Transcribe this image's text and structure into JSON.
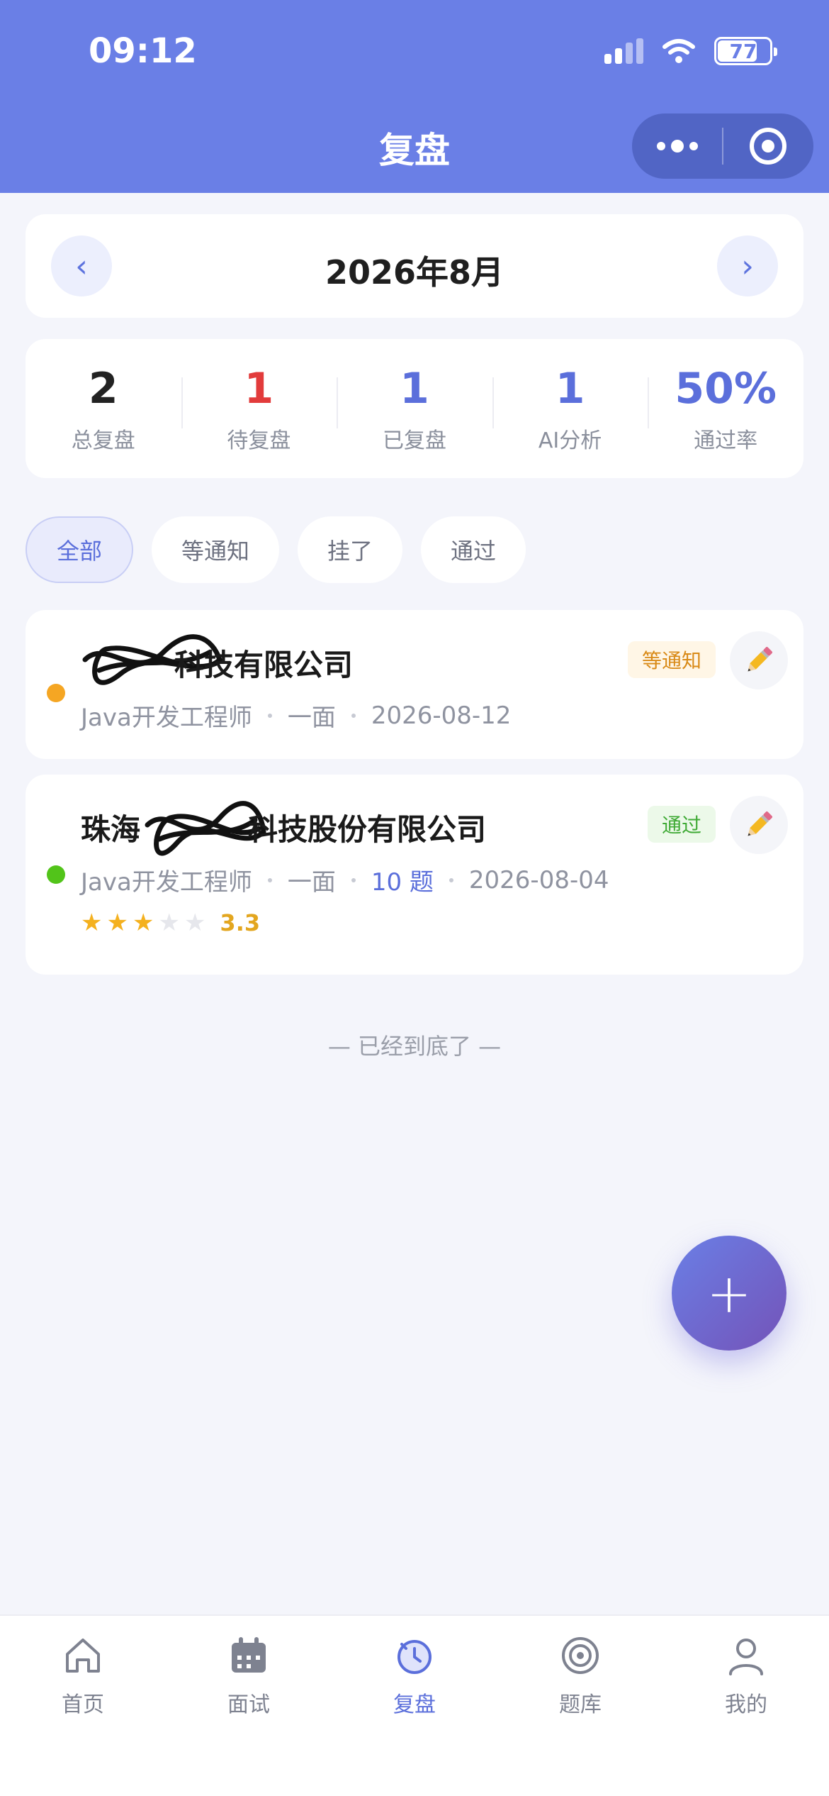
{
  "status_bar": {
    "time": "09:12",
    "battery": "77"
  },
  "header": {
    "title": "复盘"
  },
  "month_nav": {
    "label": "2026年8月",
    "prev": "‹",
    "next": "›"
  },
  "stats": [
    {
      "value": "2",
      "label": "总复盘",
      "color": "#222222"
    },
    {
      "value": "1",
      "label": "待复盘",
      "color": "#e23b3b"
    },
    {
      "value": "1",
      "label": "已复盘",
      "color": "#5b6fdb"
    },
    {
      "value": "1",
      "label": "AI分析",
      "color": "#5b6fdb"
    },
    {
      "value": "50%",
      "label": "通过率",
      "color": "#5b6fdb"
    }
  ],
  "filters": [
    {
      "label": "全部",
      "active": true
    },
    {
      "label": "等通知",
      "active": false
    },
    {
      "label": "挂了",
      "active": false
    },
    {
      "label": "通过",
      "active": false
    }
  ],
  "interviews": [
    {
      "company": "科技有限公司",
      "company_prefix": "",
      "position": "Java开发工程师",
      "round": "一面",
      "date": "2026-08-12",
      "status": "等通知",
      "status_color": "#f5a623"
    },
    {
      "company": "科技股份有限公司",
      "company_prefix": "珠海",
      "position": "Java开发工程师",
      "round": "一面",
      "questions": "10 题",
      "date": "2026-08-04",
      "status": "通过",
      "status_color": "#52c41a",
      "rating": 3.3,
      "rating_text": "3.3"
    }
  ],
  "footer_text": "— 已经到底了 —",
  "fab_label": "+",
  "tabbar": [
    {
      "label": "首页",
      "icon": "home-icon",
      "active": false
    },
    {
      "label": "面试",
      "icon": "calendar-icon",
      "active": false
    },
    {
      "label": "复盘",
      "icon": "review-clock-icon",
      "active": true
    },
    {
      "label": "题库",
      "icon": "target-icon",
      "active": false
    },
    {
      "label": "我的",
      "icon": "user-icon",
      "active": false
    }
  ],
  "colors": {
    "primary": "#6a7fe6",
    "accent": "#5b6fdb",
    "background": "#f4f5fb"
  }
}
